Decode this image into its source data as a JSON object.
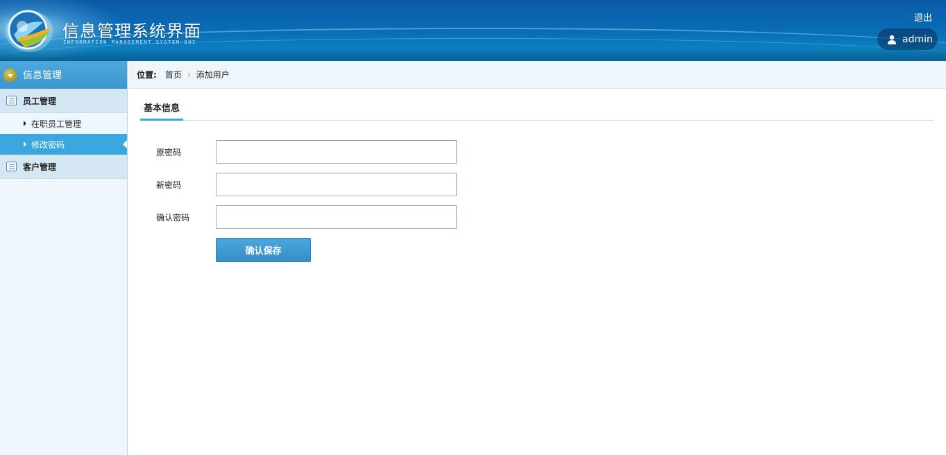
{
  "header": {
    "title": "信息管理系统界面",
    "subtitle": "INFORMATION MANAGEMENT SYSTEM GUI",
    "logout_label": "退出",
    "username": "admin"
  },
  "sidebar": {
    "title": "信息管理",
    "groups": [
      {
        "label": "员工管理",
        "items": [
          {
            "label": "在职员工管理",
            "active": false
          },
          {
            "label": "修改密码",
            "active": true
          }
        ]
      },
      {
        "label": "客户管理",
        "items": []
      }
    ]
  },
  "breadcrumb": {
    "label": "位置:",
    "items": [
      "首页",
      "添加用户"
    ],
    "separator": "›"
  },
  "main": {
    "tab_label": "基本信息",
    "form": {
      "fields": [
        {
          "label": "原密码",
          "value": "",
          "placeholder": ""
        },
        {
          "label": "新密码",
          "value": "",
          "placeholder": ""
        },
        {
          "label": "确认密码",
          "value": "",
          "placeholder": ""
        }
      ],
      "submit_label": "确认保存"
    }
  },
  "colors": {
    "header_blue": "#0a6fb8",
    "accent": "#3aa8df",
    "sidebar_bg": "#eef7fc"
  }
}
